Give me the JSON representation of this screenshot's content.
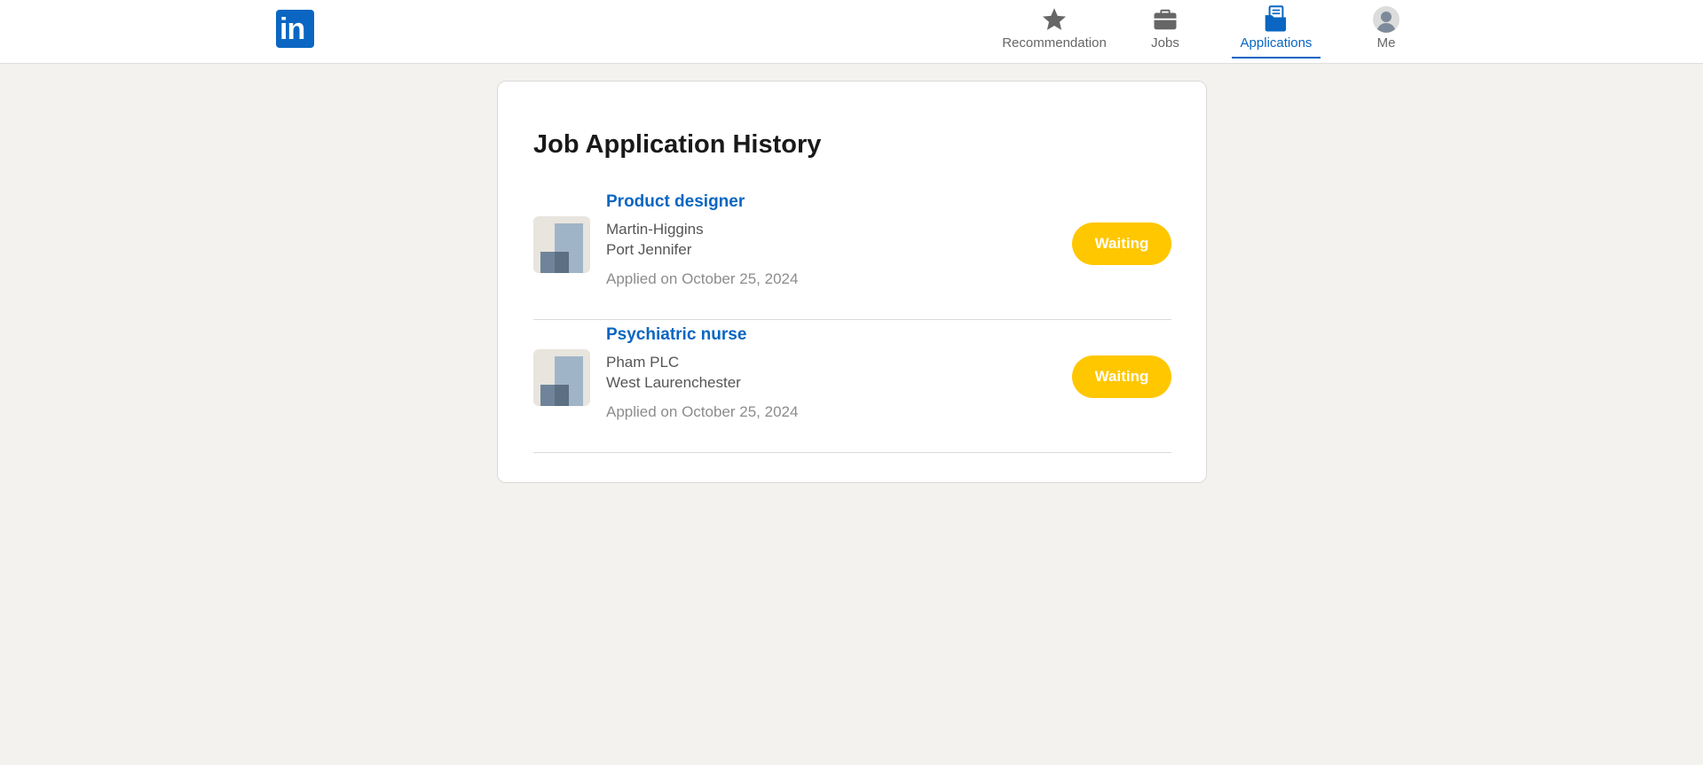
{
  "brand": {
    "logo_text": "in",
    "color": "#0a66c2"
  },
  "nav": {
    "items": [
      {
        "label": "Recommendation",
        "icon": "star-icon",
        "active": false
      },
      {
        "label": "Jobs",
        "icon": "briefcase-icon",
        "active": false
      },
      {
        "label": "Applications",
        "icon": "folder-icon",
        "active": true
      },
      {
        "label": "Me",
        "icon": "avatar-icon",
        "active": false
      }
    ]
  },
  "main": {
    "title": "Job Application History",
    "applications": [
      {
        "title": "Product designer",
        "company": "Martin-Higgins",
        "location": "Port Jennifer",
        "applied": "Applied on October 25, 2024",
        "status": "Waiting"
      },
      {
        "title": "Psychiatric nurse",
        "company": "Pham PLC",
        "location": "West Laurenchester",
        "applied": "Applied on October 25, 2024",
        "status": "Waiting"
      }
    ]
  },
  "colors": {
    "status_waiting": "#ffc700",
    "link": "#0a66c2",
    "background": "#f3f2ef"
  }
}
